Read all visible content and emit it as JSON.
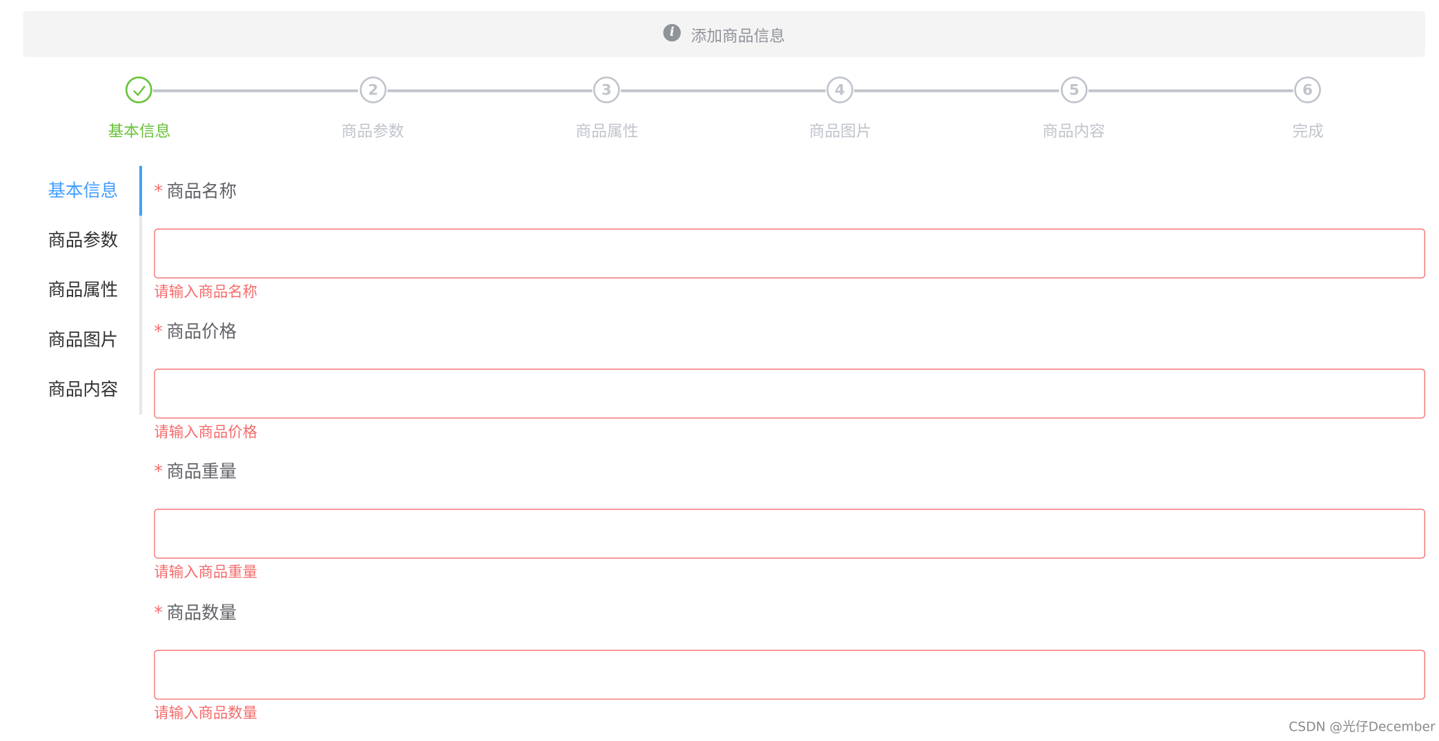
{
  "alert": {
    "icon": "info-icon",
    "title": "添加商品信息"
  },
  "steps": [
    {
      "label": "基本信息",
      "number": "",
      "status": "done",
      "icon": "check-icon"
    },
    {
      "label": "商品参数",
      "number": "2",
      "status": "wait"
    },
    {
      "label": "商品属性",
      "number": "3",
      "status": "wait"
    },
    {
      "label": "商品图片",
      "number": "4",
      "status": "wait"
    },
    {
      "label": "商品内容",
      "number": "5",
      "status": "wait"
    },
    {
      "label": "完成",
      "number": "6",
      "status": "wait"
    }
  ],
  "tabs": [
    {
      "label": "基本信息",
      "active": true
    },
    {
      "label": "商品参数",
      "active": false
    },
    {
      "label": "商品属性",
      "active": false
    },
    {
      "label": "商品图片",
      "active": false
    },
    {
      "label": "商品内容",
      "active": false
    }
  ],
  "form": {
    "required_mark": "*",
    "fields": [
      {
        "label": "商品名称",
        "value": "",
        "error": "请输入商品名称"
      },
      {
        "label": "商品价格",
        "value": "",
        "error": "请输入商品价格"
      },
      {
        "label": "商品重量",
        "value": "",
        "error": "请输入商品重量"
      },
      {
        "label": "商品数量",
        "value": "",
        "error": "请输入商品数量"
      }
    ]
  },
  "watermark": "CSDN @光仔December",
  "colors": {
    "success": "#67c23a",
    "primary": "#409eff",
    "danger": "#f56c6c",
    "muted": "#c0c4cc",
    "alert_bg": "#f4f4f5"
  }
}
